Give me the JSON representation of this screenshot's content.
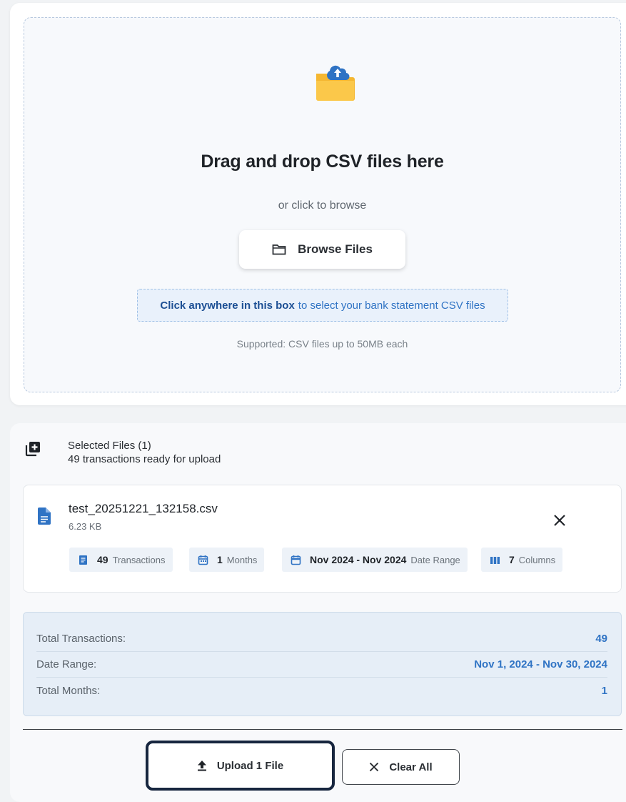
{
  "dropzone": {
    "title": "Drag and drop CSV files here",
    "subtitle": "or click to browse",
    "browse_label": "Browse Files",
    "hint_strong": "Click anywhere in this box",
    "hint_rest": "to select your bank statement CSV files",
    "supported": "Supported: CSV files up to 50MB each",
    "icons": {
      "main": "folder-upload-icon",
      "browse": "folder-icon"
    }
  },
  "selected_files": {
    "title": "Selected Files (1)",
    "subtitle": "49 transactions ready for upload",
    "icon": "add-library-icon",
    "files": [
      {
        "name": "test_20251221_132158.csv",
        "size": "6.23 KB",
        "icon": "document-icon",
        "stats": [
          {
            "value": "49",
            "label": "Transactions",
            "icon": "receipt-icon"
          },
          {
            "value": "1",
            "label": "Months",
            "icon": "calendar-icon"
          },
          {
            "value": "Nov 2024 - Nov 2024",
            "label": "Date Range",
            "icon": "calendar-icon"
          },
          {
            "value": "7",
            "label": "Columns",
            "icon": "columns-icon"
          }
        ]
      }
    ]
  },
  "summary": {
    "rows": [
      {
        "label": "Total Transactions:",
        "value": "49"
      },
      {
        "label": "Date Range:",
        "value": "Nov 1, 2024 - Nov 30, 2024"
      },
      {
        "label": "Total Months:",
        "value": "1"
      }
    ]
  },
  "actions": {
    "upload_label": "Upload 1 File",
    "clear_label": "Clear All"
  },
  "colors": {
    "accent": "#2f73c4",
    "accent_dark": "#1c4f94",
    "folder": "#f7bf3a",
    "cloud": "#2f73c4",
    "focus_border": "#17263f"
  }
}
